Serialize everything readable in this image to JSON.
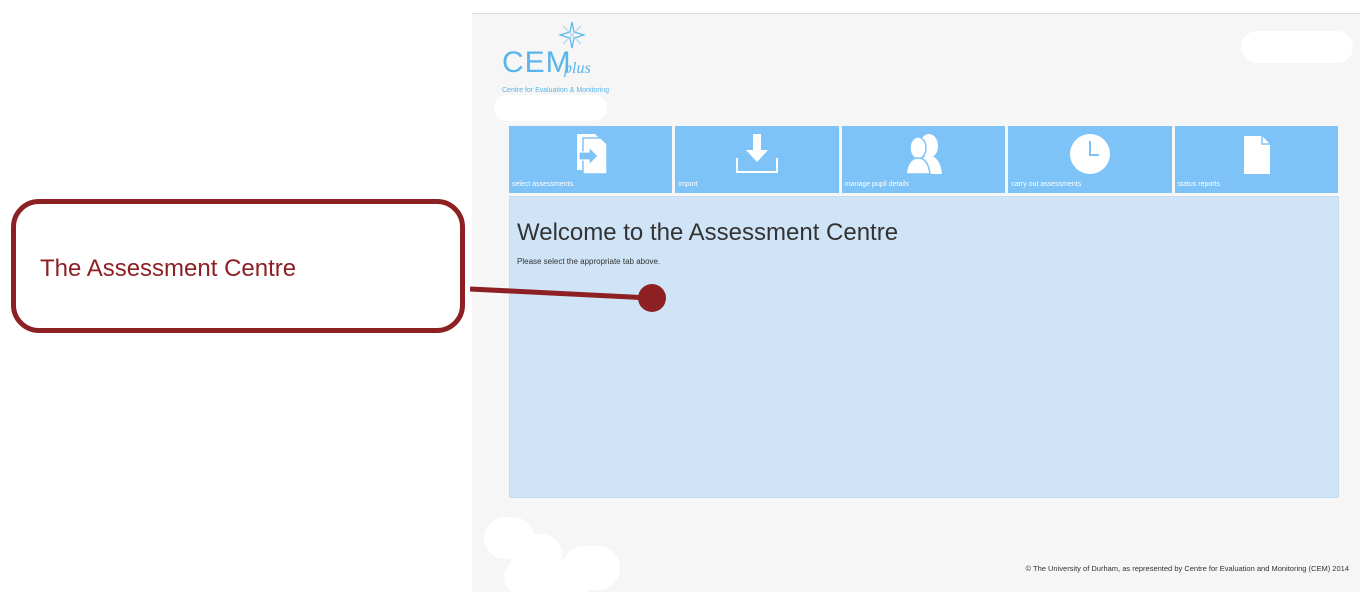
{
  "logo": {
    "brand": "CEM",
    "suffix": "plus",
    "subtitle": "Centre for Evaluation & Monitoring"
  },
  "tiles": [
    {
      "label": "select assessments",
      "icon": "document-arrow-icon"
    },
    {
      "label": "import",
      "icon": "download-tray-icon"
    },
    {
      "label": "manage pupil details",
      "icon": "people-icon"
    },
    {
      "label": "carry out assessments",
      "icon": "clock-icon"
    },
    {
      "label": "status reports",
      "icon": "document-icon"
    }
  ],
  "main": {
    "title": "Welcome to the Assessment Centre",
    "instruction": "Please select the appropriate tab above."
  },
  "footer": {
    "copyright": "© The University of Durham, as represented by Centre for Evaluation and Monitoring (CEM) 2014"
  },
  "annotation": {
    "label": "The Assessment Centre"
  },
  "colors": {
    "tile": "#7ec3f7",
    "main_panel": "#cfe4f6",
    "annotation": "#8c2023",
    "brand": "#59b6ec"
  }
}
